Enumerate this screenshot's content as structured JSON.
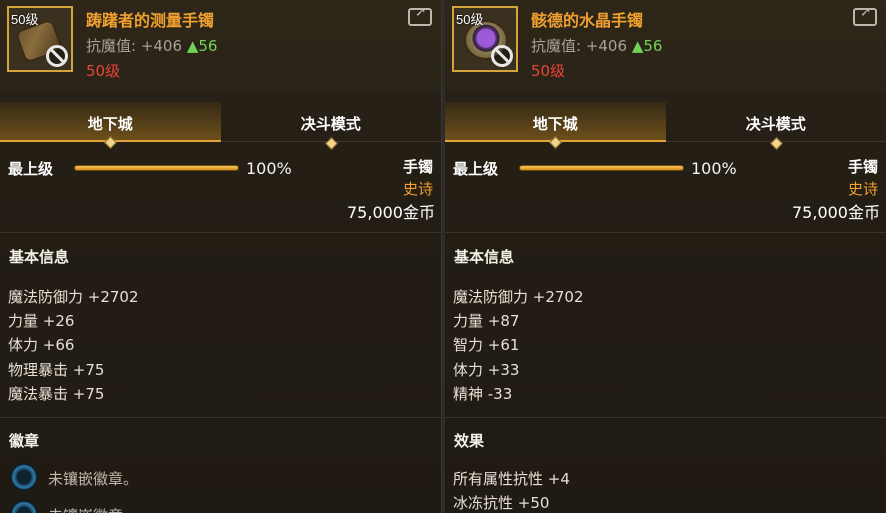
{
  "left": {
    "level_tag": "50级",
    "name": "踌躇者的测量手镯",
    "resist_label": "抗魔值: +406",
    "resist_up": "▲56",
    "level_req": "50级",
    "tabs": [
      "地下城",
      "决斗模式"
    ],
    "grade_label": "最上级",
    "grade_percent": "100%",
    "grade_fraction": 1.0,
    "item_type": "手镯",
    "rarity": "史诗",
    "price": "75,000金币",
    "basic_title": "基本信息",
    "stats": [
      "魔法防御力 +2702",
      "力量 +26",
      "体力 +66",
      "物理暴击 +75",
      "魔法暴击 +75"
    ],
    "section2_title": "徽章",
    "emblem_text": "未镶嵌徽章。"
  },
  "right": {
    "level_tag": "50级",
    "name": "骸德的水晶手镯",
    "resist_label": "抗魔值: +406",
    "resist_up": "▲56",
    "level_req": "50级",
    "tabs": [
      "地下城",
      "决斗模式"
    ],
    "grade_label": "最上级",
    "grade_percent": "100%",
    "grade_fraction": 1.0,
    "item_type": "手镯",
    "rarity": "史诗",
    "price": "75,000金币",
    "basic_title": "基本信息",
    "stats": [
      "魔法防御力 +2702",
      "力量 +87",
      "智力 +61",
      "体力 +33",
      "精神 -33"
    ],
    "section2_title": "效果",
    "effects": [
      "所有属性抗性 +4",
      "冰冻抗性 +50"
    ]
  },
  "colors": {
    "accent": "#f0a030",
    "up": "#6fd455",
    "req": "#e8453a",
    "frame": "#d4a53a"
  }
}
